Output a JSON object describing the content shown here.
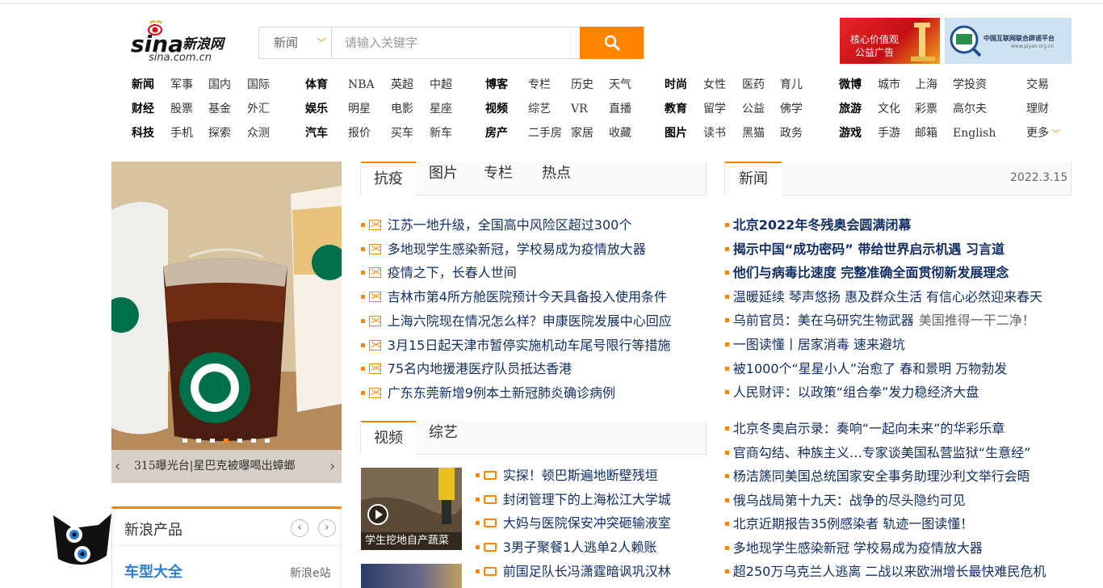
{
  "header": {
    "logo_text": "sina新浪网",
    "logo_sub": "sina.com.cn",
    "search": {
      "category": "新闻",
      "placeholder": "请输入关键字"
    },
    "ad_left": {
      "line1": "核心价值观",
      "line2": "公益广告"
    },
    "ad_right": {
      "badge": "辟谣",
      "title": "中国互联网联合辟谣平台",
      "url": "www.piyao.org.cn"
    }
  },
  "nav": [
    [
      {
        "t": "新闻",
        "b": true
      },
      {
        "t": "军事"
      },
      {
        "t": "国内"
      },
      {
        "t": "国际"
      },
      {
        "t": "体育",
        "b": true
      },
      {
        "t": "NBA"
      },
      {
        "t": "英超"
      },
      {
        "t": "中超"
      },
      {
        "t": "博客",
        "b": true
      },
      {
        "t": "专栏"
      },
      {
        "t": "历史"
      },
      {
        "t": "天气"
      },
      {
        "t": "时尚",
        "b": true
      },
      {
        "t": "女性"
      },
      {
        "t": "医药"
      },
      {
        "t": "育儿"
      },
      {
        "t": "微博",
        "b": true
      },
      {
        "t": "城市"
      },
      {
        "t": "上海"
      },
      {
        "t": "学投资"
      },
      {
        "t": "交易"
      }
    ],
    [
      {
        "t": "财经",
        "b": true
      },
      {
        "t": "股票"
      },
      {
        "t": "基金"
      },
      {
        "t": "外汇"
      },
      {
        "t": "娱乐",
        "b": true
      },
      {
        "t": "明星"
      },
      {
        "t": "电影"
      },
      {
        "t": "星座"
      },
      {
        "t": "视频",
        "b": true
      },
      {
        "t": "综艺"
      },
      {
        "t": "VR"
      },
      {
        "t": "直播"
      },
      {
        "t": "教育",
        "b": true
      },
      {
        "t": "留学"
      },
      {
        "t": "公益"
      },
      {
        "t": "佛学"
      },
      {
        "t": "旅游",
        "b": true
      },
      {
        "t": "文化"
      },
      {
        "t": "彩票"
      },
      {
        "t": "高尔夫"
      },
      {
        "t": "理财"
      }
    ],
    [
      {
        "t": "科技",
        "b": true
      },
      {
        "t": "手机"
      },
      {
        "t": "探索"
      },
      {
        "t": "众测"
      },
      {
        "t": "汽车",
        "b": true
      },
      {
        "t": "报价"
      },
      {
        "t": "买车"
      },
      {
        "t": "新车"
      },
      {
        "t": "房产",
        "b": true
      },
      {
        "t": "二手房"
      },
      {
        "t": "家居"
      },
      {
        "t": "收藏"
      },
      {
        "t": "图片",
        "b": true
      },
      {
        "t": "读书"
      },
      {
        "t": "黑猫"
      },
      {
        "t": "政务"
      },
      {
        "t": "游戏",
        "b": true
      },
      {
        "t": "手游"
      },
      {
        "t": "邮箱"
      },
      {
        "t": "English"
      },
      {
        "t": "更多"
      }
    ]
  ],
  "focus": {
    "caption": "315曝光台|星巴克被曝喝出蟑螂",
    "prev": "‹",
    "next": "›"
  },
  "products": {
    "title": "新浪产品",
    "item": "车型大全",
    "item_sub": "新浪e站"
  },
  "mid_tabs": [
    "抗疫",
    "图片",
    "专栏",
    "热点"
  ],
  "mid_news": [
    "江苏一地升级，全国高中风险区超过300个",
    "多地现学生感染新冠，学校易成为疫情放大器",
    "疫情之下，长春人世间",
    "吉林市第4所方舱医院预计今天具备投入使用条件",
    "上海六院现在情况怎么样？申康医院发展中心回应",
    "3月15日起天津市暂停实施机动车尾号限行等措施",
    "75名内地援港医疗队员抵达香港",
    "广东东莞新增9例本土新冠肺炎确诊病例"
  ],
  "video_tabs": [
    "视频",
    "综艺"
  ],
  "video_thumb_caption": "学生挖地自产蔬菜",
  "video_news": [
    "实探！顿巴斯遍地断壁残垣",
    "封闭管理下的上海松江大学城",
    "大妈与医院保安冲突砸输液室",
    "3男子聚餐1人逃单2人赖账",
    "前国足队长冯潇霆暗讽巩汉林"
  ],
  "right_tab": "新闻",
  "right_date": "2022.3.15",
  "right_news_bold": [
    "北京2022年冬残奥会圆满闭幕",
    "揭示中国“成功密码” 带给世界启示机遇 习言道",
    "他们与病毒比速度 完整准确全面贯彻新发展理念"
  ],
  "right_news_a": [
    "温暖延续 琴声悠扬 惠及群众生活 有信心必然迎来春天",
    "乌前官员：美在乌研究生物武器",
    "一图读懂丨居家消毒 速来避坑",
    "被1000个“星星小人”治愈了 春和景明 万物勃发",
    "人民财评：以政策“组合拳”发力稳经济大盘"
  ],
  "right_news_a_gray": "美国推得一干二净！",
  "right_news_b": [
    "北京冬奥启示录：奏响“一起向未来”的华彩乐章",
    "官商勾结、种族主义…专家谈美国私营监狱“生意经”",
    "杨洁篪同美国总统国家安全事务助理沙利文举行会晤",
    "俄乌战局第十九天：战争的尽头隐约可见",
    "北京近期报告35例感染者 轨迹一图读懂！",
    "多地现学生感染新冠 学校易成为疫情放大器",
    "超250万乌克兰人逃离 二战以来欧洲增长最快难民危机"
  ],
  "colors": {
    "accent": "#ff8400",
    "link": "#122e67",
    "product_link": "#2a7fd4"
  }
}
